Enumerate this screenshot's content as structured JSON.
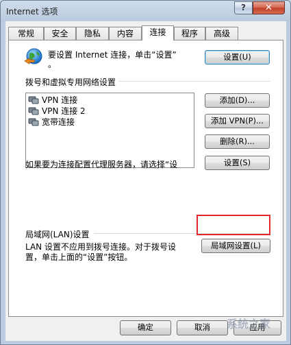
{
  "window": {
    "title": "Internet 选项",
    "help_label": "?",
    "close_label": "✕"
  },
  "tabs": [
    {
      "label": "常规"
    },
    {
      "label": "安全"
    },
    {
      "label": "隐私"
    },
    {
      "label": "内容"
    },
    {
      "label": "连接",
      "active": true
    },
    {
      "label": "程序"
    },
    {
      "label": "高级"
    }
  ],
  "setup": {
    "icon": "globe-network-icon",
    "text_line1": "要设置 Internet 连接，单击“设置”",
    "text_line2": "。",
    "button": "设置(U)"
  },
  "dialup": {
    "heading": "拨号和虚拟专用网络设置",
    "items": [
      {
        "label": "VPN 连接",
        "icon": "network-connection-icon"
      },
      {
        "label": "VPN 连接 2",
        "icon": "network-connection-icon"
      },
      {
        "label": "宽带连接",
        "icon": "network-connection-icon"
      }
    ],
    "add_button": "添加(D)...",
    "add_vpn_button": "添加 VPN(P)...",
    "remove_button": "删除(R)...",
    "proxy_note": "如果要为连接配置代理服务器，请选择“设",
    "settings_button": "设置(S)"
  },
  "lan": {
    "heading": "局域网(LAN)设置",
    "note_line1": "LAN 设置不应用到拨号连接。对于拨号设",
    "note_line2": "置，单击上面的“设置”按钮。",
    "button": "局域网设置(L)"
  },
  "footer": {
    "ok_button": "确定",
    "cancel_button": "取消",
    "apply_button": "应用"
  },
  "watermark": {
    "text": "系统之家"
  },
  "colors": {
    "highlight_border": "#e2262b",
    "close_button": "#c03d27",
    "title_bar": "#bccbdf"
  }
}
